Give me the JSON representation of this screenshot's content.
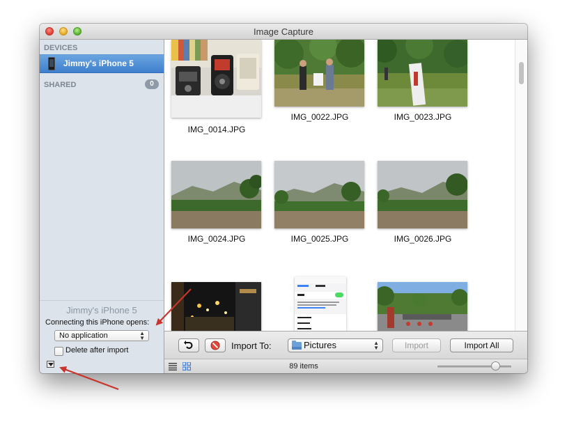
{
  "window": {
    "title": "Image Capture"
  },
  "sidebar": {
    "devices_header": "DEVICES",
    "device_name": "Jimmy's iPhone 5",
    "shared_header": "SHARED",
    "shared_count": "0",
    "panel": {
      "device_title": "Jimmy's iPhone 5",
      "connecting_text": "Connecting this iPhone opens:",
      "app_popup_value": "No application",
      "delete_checkbox_label": "Delete after import"
    }
  },
  "photos": [
    {
      "name": "IMG_0014.JPG",
      "kind": "radios"
    },
    {
      "name": "IMG_0022.JPG",
      "kind": "people"
    },
    {
      "name": "IMG_0023.JPG",
      "kind": "field"
    },
    {
      "name": "IMG_0024.JPG",
      "kind": "landscape"
    },
    {
      "name": "IMG_0025.JPG",
      "kind": "landscape"
    },
    {
      "name": "IMG_0026.JPG",
      "kind": "landscape"
    },
    {
      "name": "",
      "kind": "night"
    },
    {
      "name": "",
      "kind": "screenshot"
    },
    {
      "name": "",
      "kind": "street"
    }
  ],
  "toolbar": {
    "import_to_label": "Import To:",
    "destination": "Pictures",
    "import_button": "Import",
    "import_all_button": "Import All"
  },
  "status": {
    "items_count": "89 items"
  },
  "colors": {
    "selection": "#3f7fcd",
    "annotation_arrow": "#c8352c"
  }
}
